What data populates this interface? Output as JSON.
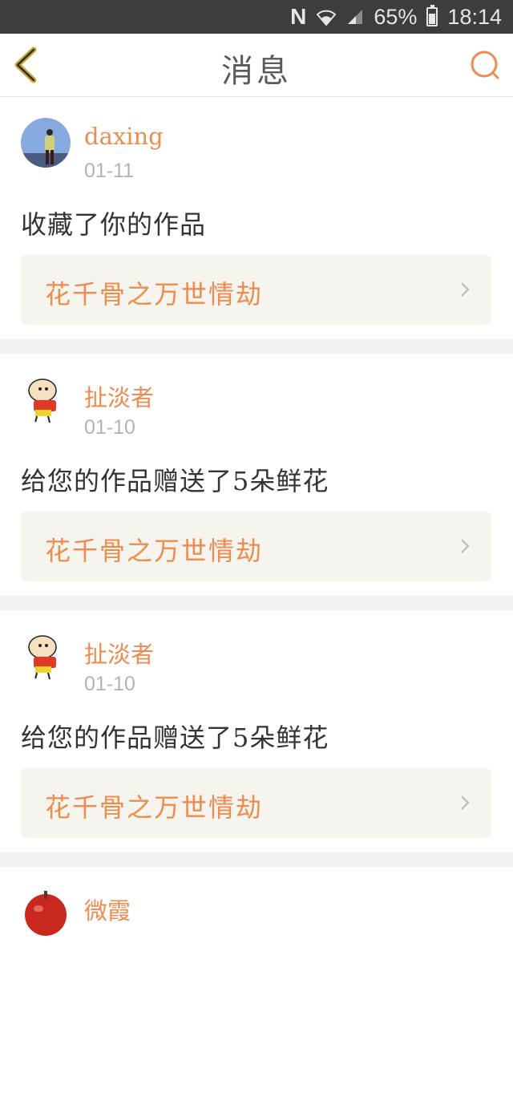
{
  "status_bar": {
    "carrier_icon": "N",
    "battery": "65%",
    "battery_level": 0.65,
    "time": "18:14"
  },
  "header": {
    "title": "消息",
    "back_icon": "chevron-left-icon",
    "search_icon": "search-icon"
  },
  "colors": {
    "accent": "#ef8b4f",
    "text": "#333333",
    "muted": "#b4b4b4",
    "work_bg": "#f5f4ef"
  },
  "messages": [
    {
      "user": "daxing",
      "date": "01-11",
      "action": "收藏了你的作品",
      "work": "花千骨之万世情劫",
      "avatar": "photo-avatar"
    },
    {
      "user": "扯淡者",
      "date": "01-10",
      "action": "给您的作品赠送了5朵鲜花",
      "work": "花千骨之万世情劫",
      "avatar": "cartoon-avatar"
    },
    {
      "user": "扯淡者",
      "date": "01-10",
      "action": "给您的作品赠送了5朵鲜花",
      "work": "花千骨之万世情劫",
      "avatar": "cartoon-avatar"
    },
    {
      "user": "微霞",
      "date": "",
      "action": "",
      "work": "",
      "avatar": "apple-avatar"
    }
  ]
}
